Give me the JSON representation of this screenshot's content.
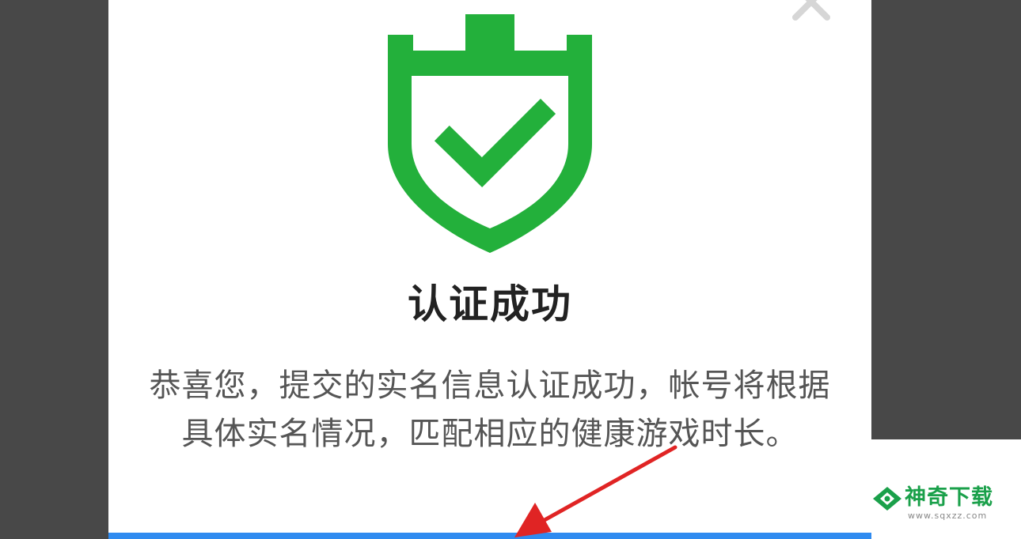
{
  "dialog": {
    "title": "认证成功",
    "message": "恭喜您，提交的实名信息认证成功，帐号将根据具体实名情况，匹配相应的健康游戏时长。",
    "icon": "shield-check-icon",
    "close_icon": "close-icon"
  },
  "watermark": {
    "brand": "神奇下载",
    "url": "www.sqxzz.com"
  },
  "colors": {
    "shield_green": "#23b03b",
    "confirm_blue": "#2f8bf0",
    "arrow_red": "#e02424",
    "brand_green": "#1aa04a"
  }
}
